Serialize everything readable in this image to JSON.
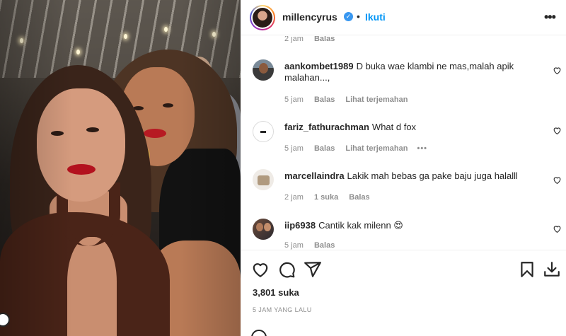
{
  "header": {
    "username": "millencyrus",
    "verified_badge": "✓",
    "separator": "•",
    "follow_label": "Ikuti",
    "more_icon": "more-horizontal-icon"
  },
  "comments": [
    {
      "username": "",
      "text": "",
      "time": "2 jam",
      "reply": "Balas",
      "partial": true
    },
    {
      "username": "aankombet1989",
      "text": "D buka wae klambi ne mas,malah apik malahan...,",
      "time": "5 jam",
      "reply": "Balas",
      "translate": "Lihat terjemahan"
    },
    {
      "username": "fariz_fathurachman",
      "text": "What d fox",
      "time": "5 jam",
      "reply": "Balas",
      "translate": "Lihat terjemahan",
      "more": "•••"
    },
    {
      "username": "marcellaindra",
      "text": "Lakik mah bebas ga pake baju juga halalll",
      "time": "2 jam",
      "likes": "1 suka",
      "reply": "Balas"
    },
    {
      "username": "iip6938",
      "text": "Cantik kak milenn 😍",
      "time": "5 jam",
      "reply": "Balas"
    }
  ],
  "actions": {
    "icons": [
      "heart-icon",
      "comment-icon",
      "share-icon",
      "save-icon",
      "download-icon"
    ],
    "likes": "3,801 suka",
    "timestamp": "5 JAM YANG LALU"
  },
  "colors": {
    "accent": "#0095f6",
    "text": "#262626",
    "muted": "#8e8e8e",
    "border": "#efefef"
  }
}
